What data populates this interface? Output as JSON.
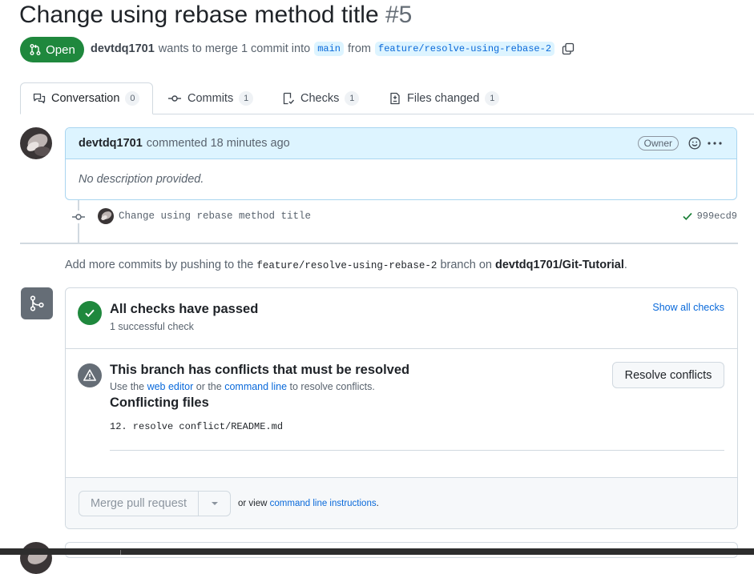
{
  "header": {
    "title": "Change using rebase method title",
    "number": "#5",
    "state": "Open",
    "author": "devtdq1701",
    "meta_text": "wants to merge 1 commit into",
    "base_branch": "main",
    "from_text": "from",
    "head_branch": "feature/resolve-using-rebase-2"
  },
  "tabs": [
    {
      "label": "Conversation",
      "count": "0"
    },
    {
      "label": "Commits",
      "count": "1"
    },
    {
      "label": "Checks",
      "count": "1"
    },
    {
      "label": "Files changed",
      "count": "1"
    }
  ],
  "comment": {
    "author": "devtdq1701",
    "action": "commented 18 minutes ago",
    "badge": "Owner",
    "body": "No description provided."
  },
  "commit": {
    "message": "Change using rebase method title",
    "sha": "999ecd9"
  },
  "push_hint": {
    "prefix": "Add more commits by pushing to the",
    "branch": "feature/resolve-using-rebase-2",
    "middle": "branch on",
    "repo": "devtdq1701/Git-Tutorial",
    "suffix": "."
  },
  "checks": {
    "title": "All checks have passed",
    "subtitle": "1 successful check",
    "show_all": "Show all checks"
  },
  "conflicts": {
    "title": "This branch has conflicts that must be resolved",
    "use_the": "Use the",
    "web_editor": "web editor",
    "or_the": "or the",
    "command_line": "command line",
    "to_resolve": "to resolve conflicts.",
    "files_heading": "Conflicting files",
    "file": "12. resolve conflict/README.md",
    "resolve_button": "Resolve conflicts"
  },
  "merge": {
    "button": "Merge pull request",
    "or_view": "or view",
    "instructions": "command line instructions",
    "period": "."
  },
  "colors": {
    "open_green": "#1f883d",
    "link_blue": "#0969da",
    "comment_header": "#ddf4ff",
    "conflict_icon": "#656d76"
  }
}
